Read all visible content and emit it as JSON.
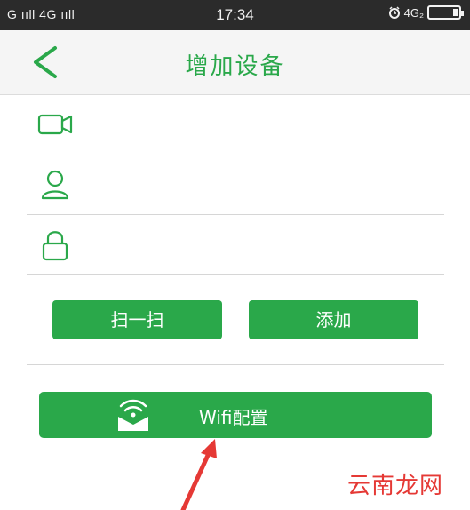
{
  "status_bar": {
    "left": "G ııll 4G ııll",
    "time": "17:34",
    "network": "4G₂"
  },
  "header": {
    "title": "增加设备"
  },
  "form": {
    "device_id": "██████",
    "username": "████",
    "password": "███"
  },
  "buttons": {
    "scan": "扫一扫",
    "add": "添加",
    "wifi": "Wifi配置"
  },
  "watermark": "云南龙网",
  "colors": {
    "accent": "#2aa84a",
    "status_bar": "#2b2b2b",
    "arrow": "#e53935"
  },
  "icons": [
    "back-chevron-icon",
    "camera-icon",
    "user-icon",
    "lock-icon",
    "wifi-envelope-icon",
    "alarm-icon",
    "battery-icon"
  ]
}
